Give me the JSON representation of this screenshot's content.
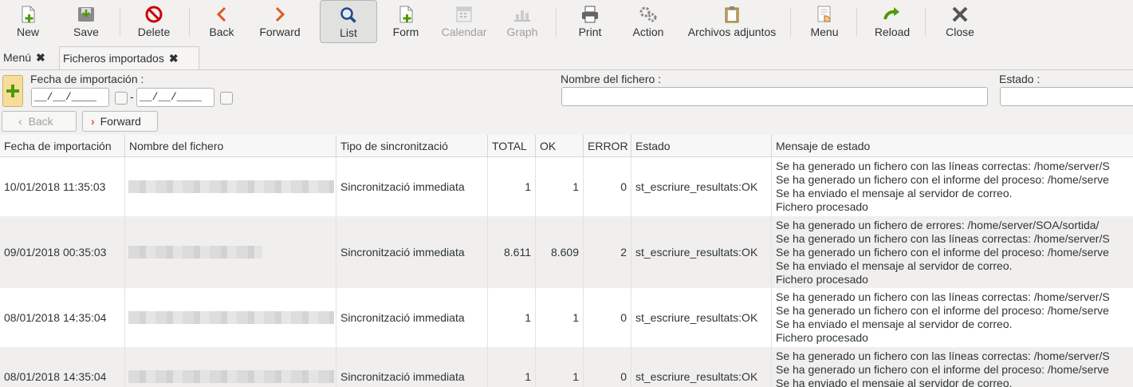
{
  "toolbar": {
    "new": "New",
    "save": "Save",
    "delete": "Delete",
    "back": "Back",
    "forward": "Forward",
    "list": "List",
    "form": "Form",
    "calendar": "Calendar",
    "graph": "Graph",
    "print": "Print",
    "action": "Action",
    "attachments": "Archivos adjuntos",
    "menu": "Menu",
    "reload": "Reload",
    "close": "Close"
  },
  "tabs": [
    {
      "label": "Menú",
      "close": "✖"
    },
    {
      "label": "Ficheros importados",
      "close": "✖"
    }
  ],
  "filter": {
    "date_label": "Fecha de importación :",
    "date_from": "__/__/____",
    "date_sep": "-",
    "date_to": "__/__/____",
    "file_label": "Nombre del fichero :",
    "file_value": "",
    "status_label": "Estado :",
    "status_value": "",
    "back_label": "Back",
    "forward_label": "Forward"
  },
  "columns": [
    "Fecha de importación",
    "Nombre del fichero",
    "Tipo de sincronització",
    "TOTAL",
    "OK",
    "ERROR",
    "Estado",
    "Mensaje de estado"
  ],
  "rows": [
    {
      "date": "10/01/2018 11:35:03",
      "type": "Sincronització immediata",
      "total": "1",
      "ok": "1",
      "error": "0",
      "status": "st_escriure_resultats:OK",
      "messages": [
        "Se ha generado un fichero con las líneas correctas: /home/server/S",
        "Se ha generado un fichero con el informe del proceso: /home/serve",
        "Se ha enviado el mensaje al servidor de correo.",
        "Fichero procesado"
      ]
    },
    {
      "date": "09/01/2018 00:35:03",
      "type": "Sincronització immediata",
      "total": "8.611",
      "ok": "8.609",
      "error": "2",
      "status": "st_escriure_resultats:OK",
      "messages": [
        "Se ha generado un fichero de errores: /home/server/SOA/sortida/",
        "Se ha generado un fichero con las líneas correctas: /home/server/S",
        "Se ha generado un fichero con el informe del proceso: /home/serve",
        "Se ha enviado el mensaje al servidor de correo.",
        "Fichero procesado"
      ]
    },
    {
      "date": "08/01/2018 14:35:04",
      "type": "Sincronització immediata",
      "total": "1",
      "ok": "1",
      "error": "0",
      "status": "st_escriure_resultats:OK",
      "messages": [
        "Se ha generado un fichero con las líneas correctas: /home/server/S",
        "Se ha generado un fichero con el informe del proceso: /home/serve",
        "Se ha enviado el mensaje al servidor de correo.",
        "Fichero procesado"
      ]
    },
    {
      "date": "08/01/2018 14:35:04",
      "type": "Sincronització immediata",
      "total": "1",
      "ok": "1",
      "error": "0",
      "status": "st_escriure_resultats:OK",
      "messages": [
        "Se ha generado un fichero con las líneas correctas: /home/server/S",
        "Se ha generado un fichero con el informe del proceso: /home/serve",
        "Se ha enviado el mensaje al servidor de correo."
      ]
    }
  ]
}
